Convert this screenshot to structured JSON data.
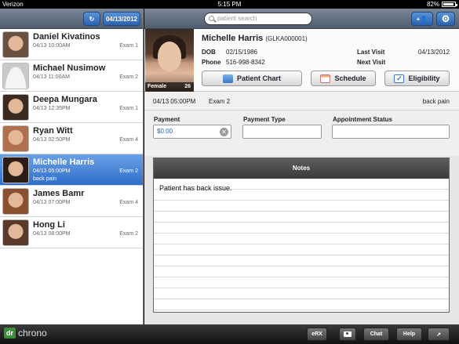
{
  "status_bar": {
    "carrier": "Verizon",
    "time": "5:15 PM",
    "battery": "82%"
  },
  "left_toolbar": {
    "date": "04/13/2012"
  },
  "patients": [
    {
      "name": "Daniel Kivatinos",
      "datetime": "04/13 10:00AM",
      "exam": "Exam 1",
      "note": "",
      "avatar": "person-photo"
    },
    {
      "name": "Michael Nusimow",
      "datetime": "04/13 11:00AM",
      "exam": "Exam 2",
      "note": "",
      "avatar": "placeholder"
    },
    {
      "name": "Deepa Mungara",
      "datetime": "04/13 12:35PM",
      "exam": "Exam 1",
      "note": "",
      "avatar": "person-photo"
    },
    {
      "name": "Ryan Witt",
      "datetime": "04/13 02:50PM",
      "exam": "Exam 4",
      "note": "",
      "avatar": "person-photo"
    },
    {
      "name": "Michelle Harris",
      "datetime": "04/13 05:00PM",
      "exam": "Exam 2",
      "note": "back pain",
      "avatar": "person-photo"
    },
    {
      "name": "James Bamr",
      "datetime": "04/13 07:00PM",
      "exam": "Exam 4",
      "note": "",
      "avatar": "person-photo"
    },
    {
      "name": "Hong Li",
      "datetime": "04/13 08:00PM",
      "exam": "Exam 2",
      "note": "",
      "avatar": "person-photo"
    }
  ],
  "search": {
    "placeholder": "patient search"
  },
  "patient": {
    "name": "Michelle Harris",
    "id": "(GLKA000001)",
    "gender": "Female",
    "age": "26",
    "dob_label": "DOB",
    "dob": "02/15/1986",
    "phone_label": "Phone",
    "phone": "516-998-8342",
    "last_visit_label": "Last Visit",
    "last_visit": "04/13/2012",
    "next_visit_label": "Next Visit",
    "next_visit": ""
  },
  "actions": {
    "chart": "Patient Chart",
    "schedule": "Schedule",
    "eligibility": "Eligibility"
  },
  "appointment": {
    "datetime": "04/13 05:00PM",
    "exam": "Exam 2",
    "reason": "back pain"
  },
  "form": {
    "payment_label": "Payment",
    "payment_value": "$0.00",
    "payment_type_label": "Payment Type",
    "payment_type_value": "",
    "status_label": "Appointment Status",
    "status_value": ""
  },
  "notes": {
    "title": "Notes",
    "text": "Patient has back issue."
  },
  "bottom_bar": {
    "logo_dr": "dr",
    "logo_text": "chrono",
    "erx": "eRX",
    "chat": "Chat",
    "help": "Help"
  },
  "colors": {
    "accent": "#2f6fc9",
    "toolbar": "#5b6778"
  }
}
